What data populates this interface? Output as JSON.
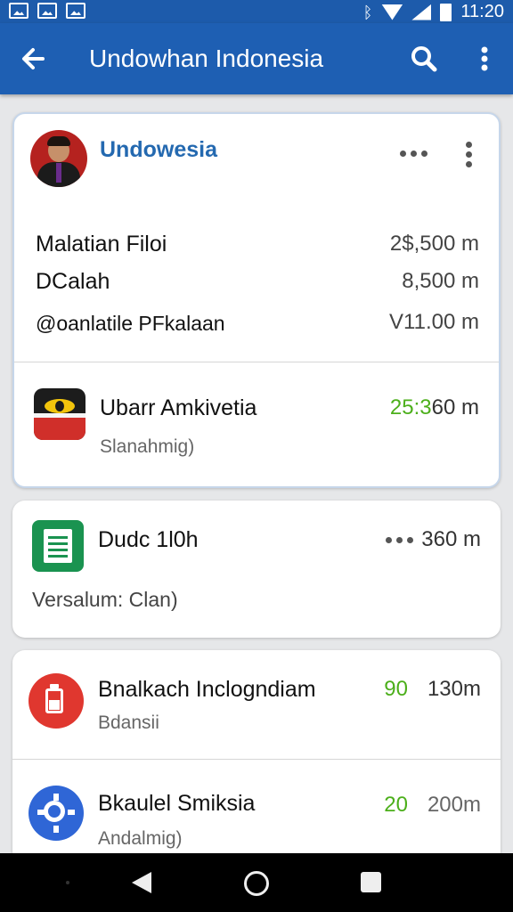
{
  "status_bar": {
    "left_icons": [
      "image-icon",
      "photo-icon",
      "gallery-icon"
    ],
    "right_icons": [
      "bluetooth-icon",
      "wifi-icon",
      "signal-icon",
      "battery-icon"
    ],
    "time": "11:20"
  },
  "app_bar": {
    "title": "Undowhan Indonesia",
    "icons": [
      "back-arrow-icon",
      "search-icon",
      "more-vert-icon"
    ]
  },
  "account_card": {
    "account_name": "Undowesia",
    "rows": [
      {
        "label": "Malatian Filoi",
        "value": "2$,500 m"
      },
      {
        "label": "DCalah",
        "value": "8,500 m"
      },
      {
        "label": "@oanlatile PFkalaan",
        "value": "V11.00 m"
      }
    ],
    "item": {
      "title": "Ubarr Amkivetia",
      "subtitle": "Slanahmig)",
      "value_green": "25:3",
      "value": "60 m"
    }
  },
  "card2": {
    "title": "Dudc 1l0h",
    "subtitle": "Versalum: Clan)",
    "value": "360 m"
  },
  "card3": {
    "items": [
      {
        "title": "Bnalkach Inclogndiam",
        "subtitle": "Bdansii",
        "value_green": "90",
        "value": "130m"
      },
      {
        "title": "Bkaulel Smiksia",
        "subtitle": "Andalmig)",
        "value_green": "20",
        "value": "200m"
      }
    ]
  },
  "colors": {
    "primary": "#1e5fb3",
    "accent_text": "#2469b0",
    "green": "#4caf1b",
    "background": "#e6e7e9"
  }
}
